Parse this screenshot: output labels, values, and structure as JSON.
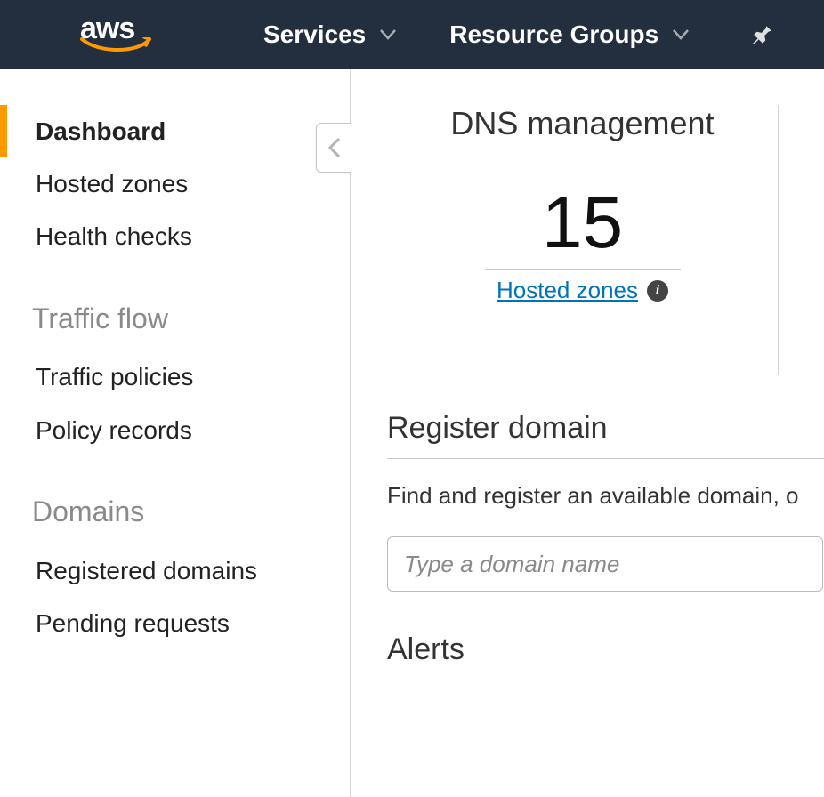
{
  "topnav": {
    "logo_text": "aws",
    "services_label": "Services",
    "resource_groups_label": "Resource Groups"
  },
  "sidebar": {
    "items": [
      {
        "label": "Dashboard",
        "active": true
      },
      {
        "label": "Hosted zones"
      },
      {
        "label": "Health checks"
      }
    ],
    "section_traffic": "Traffic flow",
    "traffic_items": [
      {
        "label": "Traffic policies"
      },
      {
        "label": "Policy records"
      }
    ],
    "section_domains": "Domains",
    "domain_items": [
      {
        "label": "Registered domains"
      },
      {
        "label": "Pending requests"
      }
    ]
  },
  "main": {
    "dns_title": "DNS management",
    "hosted_zones_count": "15",
    "hosted_zones_link": "Hosted zones",
    "register_title": "Register domain",
    "register_desc": "Find and register an available domain, o",
    "domain_placeholder": "Type a domain name",
    "alerts_title": "Alerts"
  }
}
